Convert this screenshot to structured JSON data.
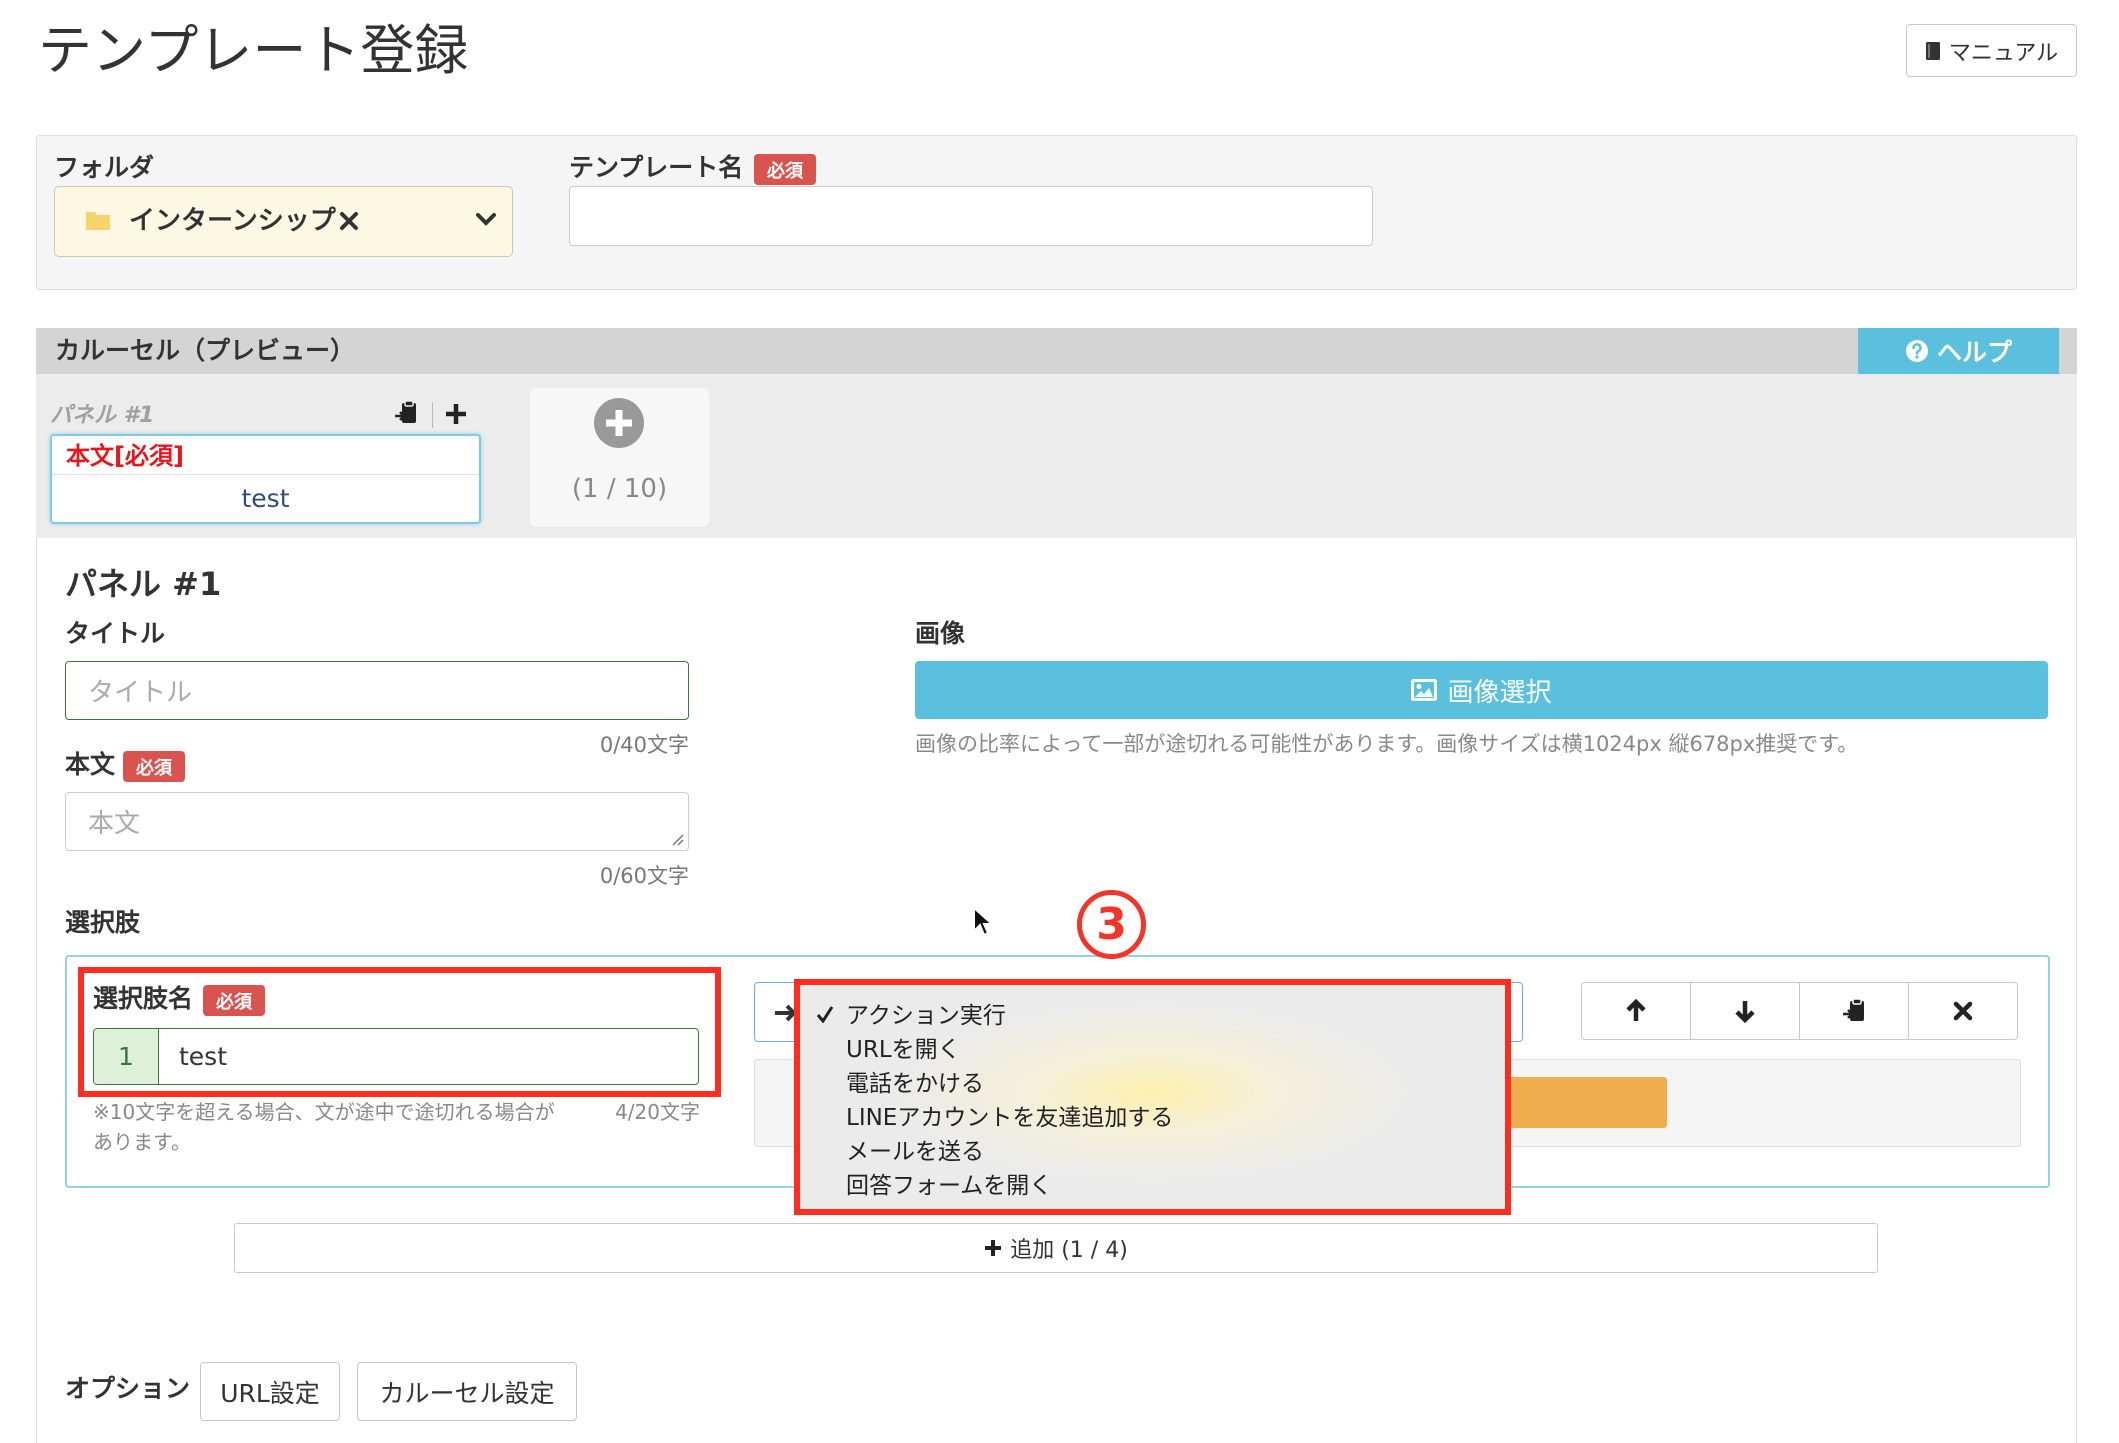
{
  "page": {
    "title": "テンプレート登録"
  },
  "header": {
    "manual_label": "マニュアル",
    "manual_icon": "book-icon"
  },
  "form": {
    "folder_label": "フォルダ",
    "folder_value": "インターンシップ",
    "template_name_label": "テンプレート名",
    "required_badge": "必須",
    "template_name_value": ""
  },
  "carousel": {
    "section_title": "カルーセル（プレビュー）",
    "help_label": "ヘルプ",
    "panels": [
      {
        "label": "パネル #1",
        "body_label": "本文[必須]",
        "choice_text": "test"
      }
    ],
    "panel_count": "(1 / 10)"
  },
  "panel_editor": {
    "heading": "パネル #1",
    "title_label": "タイトル",
    "title_placeholder": "タイトル",
    "title_counter": "0/40文字",
    "body_label": "本文",
    "body_required": "必須",
    "body_placeholder": "本文",
    "body_counter": "0/60文字",
    "image_label": "画像",
    "image_button": "画像選択",
    "image_note": "画像の比率によって一部が途切れる可能性があります。画像サイズは横1024px 縦678px推奨です。",
    "choices_label": "選択肢"
  },
  "choice": {
    "name_label": "選択肢名",
    "required": "必須",
    "index": "1",
    "value": "test",
    "note_line1": "※10文字を超える場合、文が途中で途切れる場合が",
    "note_line2": "あります。",
    "counter": "4/20文字",
    "action_options": [
      "アクション実行",
      "URLを開く",
      "電話をかける",
      "LINEアカウントを友達追加する",
      "メールを送る",
      "回答フォームを開く"
    ],
    "selected_index": 0
  },
  "add_choice": {
    "label": "追加 (1 / 4)"
  },
  "options": {
    "label": "オプション",
    "url_button": "URL設定",
    "carousel_button": "カルーセル設定"
  },
  "annotation": {
    "step_number": "3"
  },
  "colors": {
    "required_red": "#d9534f",
    "info_blue": "#5bc0de",
    "success_green": "#3c763d",
    "warning_orange": "#f0ad4e",
    "folder_bg": "#fcf8e3",
    "annotation_red": "#ff2d1e"
  }
}
